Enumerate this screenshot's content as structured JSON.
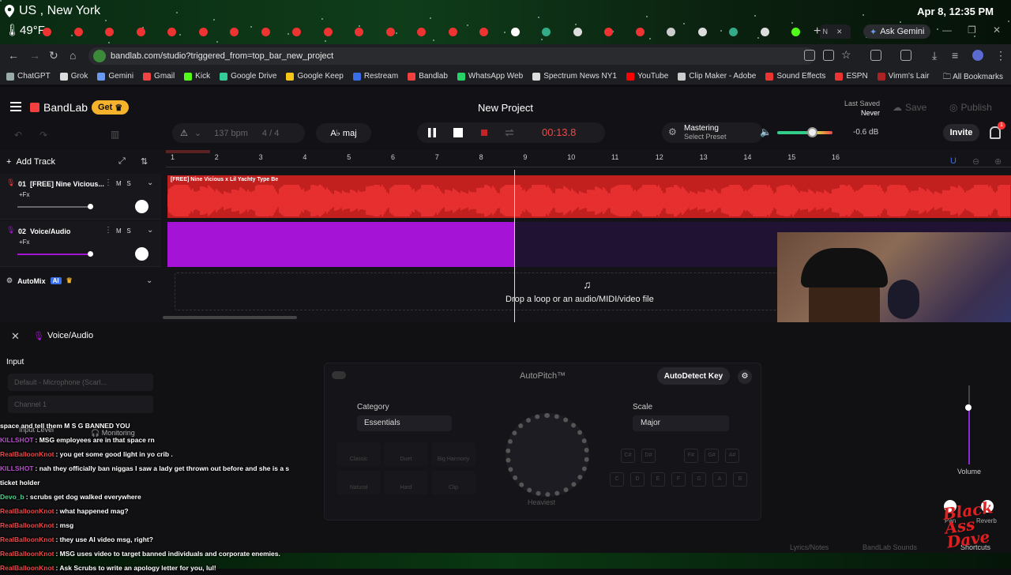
{
  "overlay": {
    "location": "US , New York",
    "temperature": "49°F",
    "datetime": "Apr 8, 12:35 PM",
    "watermark_lines": [
      "Black",
      "Ass",
      "Dave"
    ]
  },
  "browser": {
    "ask_gemini": "Ask Gemini",
    "url": "bandlab.com/studio?triggered_from=top_bar_new_project",
    "active_tab_label": "N",
    "bookmarks": [
      {
        "label": "ChatGPT",
        "color": "#9aa"
      },
      {
        "label": "Grok",
        "color": "#ddd"
      },
      {
        "label": "Gemini",
        "color": "#6a9af0"
      },
      {
        "label": "Gmail",
        "color": "#e44"
      },
      {
        "label": "Kick",
        "color": "#53fc18"
      },
      {
        "label": "Google Drive",
        "color": "#3c9"
      },
      {
        "label": "Google Keep",
        "color": "#f5c518"
      },
      {
        "label": "Restream",
        "color": "#3a6ee8"
      },
      {
        "label": "Bandlab",
        "color": "#f2403f"
      },
      {
        "label": "WhatsApp Web",
        "color": "#25d366"
      },
      {
        "label": "Spectrum News NY1",
        "color": "#ddd"
      },
      {
        "label": "YouTube",
        "color": "#f00"
      },
      {
        "label": "Clip Maker - Adobe",
        "color": "#ccc"
      },
      {
        "label": "Sound Effects",
        "color": "#e33"
      },
      {
        "label": "ESPN",
        "color": "#e33"
      },
      {
        "label": "Vimm's Lair",
        "color": "#a22"
      }
    ],
    "all_bookmarks": "All Bookmarks"
  },
  "header": {
    "brand": "BandLab",
    "get_label": "Get",
    "project_title": "New Project",
    "last_saved_label": "Last Saved",
    "last_saved_value": "Never",
    "save_label": "Save",
    "publish_label": "Publish",
    "bpm_value": "137",
    "bpm_unit": "bpm",
    "time_sig": "4 / 4",
    "key": "A♭ maj",
    "time": "00:13.8",
    "mastering_title": "Mastering",
    "mastering_sub": "Select Preset",
    "volume_db": "-0.6 dB",
    "volume_level": 0.64,
    "invite_label": "Invite",
    "notif_count": "1"
  },
  "tracks": {
    "add_track_label": "Add Track",
    "items": [
      {
        "number": "01",
        "name": "[FREE] Nine Vicious...",
        "fx": "+Fx",
        "mute": "M",
        "solo": "S",
        "region_label": "[FREE] Nine Vicious x Lil Yachty Type Be"
      },
      {
        "number": "02",
        "name": "Voice/Audio",
        "fx": "+Fx",
        "mute": "M",
        "solo": "S"
      }
    ],
    "automix_label": "AutoMix",
    "automix_badge": "AI",
    "ruler": [
      "1",
      "2",
      "3",
      "4",
      "5",
      "6",
      "7",
      "8",
      "9",
      "10",
      "11",
      "12",
      "13",
      "14",
      "15",
      "16"
    ],
    "drop_text": "Drop a loop or an audio/MIDI/video file"
  },
  "panel": {
    "title": "Voice/Audio",
    "input_label": "Input",
    "input_device": "Default - Microphone (Scarl...",
    "channel": "Channel 1",
    "input_level_label": "Input Level",
    "monitoring_label": "Monitoring",
    "autopitch_label": "AutoPitch™",
    "autodetect_label": "AutoDetect Key",
    "category_label": "Category",
    "category_value": "Essentials",
    "presets": [
      "Classic",
      "Duet",
      "Big Harmony",
      "Natural",
      "Hard",
      "Clip"
    ],
    "scale_label": "Scale",
    "scale_value": "Major",
    "knob_label": "Heaviest",
    "volume_label": "Volume",
    "pan_label": "Pan",
    "reverb_label": "Reverb",
    "bottom_links": [
      "Lyrics/Notes",
      "BandLab Sounds",
      "Shortcuts"
    ]
  },
  "chat": [
    {
      "user": "",
      "text": "space and tell them M S G BANNED YOU",
      "color": "#fff"
    },
    {
      "user": "KILLSHOT",
      "text": ": MSG employees are in that space rn",
      "color": "#c04ad6"
    },
    {
      "user": "RealBalloonKnot",
      "text": ": you get some good light in yo crib .",
      "color": "#e84a4a"
    },
    {
      "user": "KILLSHOT",
      "text": ": nah they officially ban niggas I saw a lady get thrown out before and she is a s",
      "color": "#c04ad6"
    },
    {
      "user": "",
      "text": "ticket holder",
      "color": "#fff"
    },
    {
      "user": "Devo_b",
      "text": ": scrubs get dog walked everywhere",
      "color": "#4ad68a"
    },
    {
      "user": "RealBalloonKnot",
      "text": ": what happened mag?",
      "color": "#e84a4a"
    },
    {
      "user": "RealBalloonKnot",
      "text": ": msg",
      "color": "#e84a4a"
    },
    {
      "user": "RealBalloonKnot",
      "text": ": they use AI video msg, right?",
      "color": "#e84a4a"
    },
    {
      "user": "RealBalloonKnot",
      "text": ": MSG uses video to target banned individuals and corporate enemies.",
      "color": "#e84a4a"
    },
    {
      "user": "RealBalloonKnot",
      "text": ": Ask Scrubs to write an apology letter for you, lul!",
      "color": "#e84a4a"
    }
  ]
}
